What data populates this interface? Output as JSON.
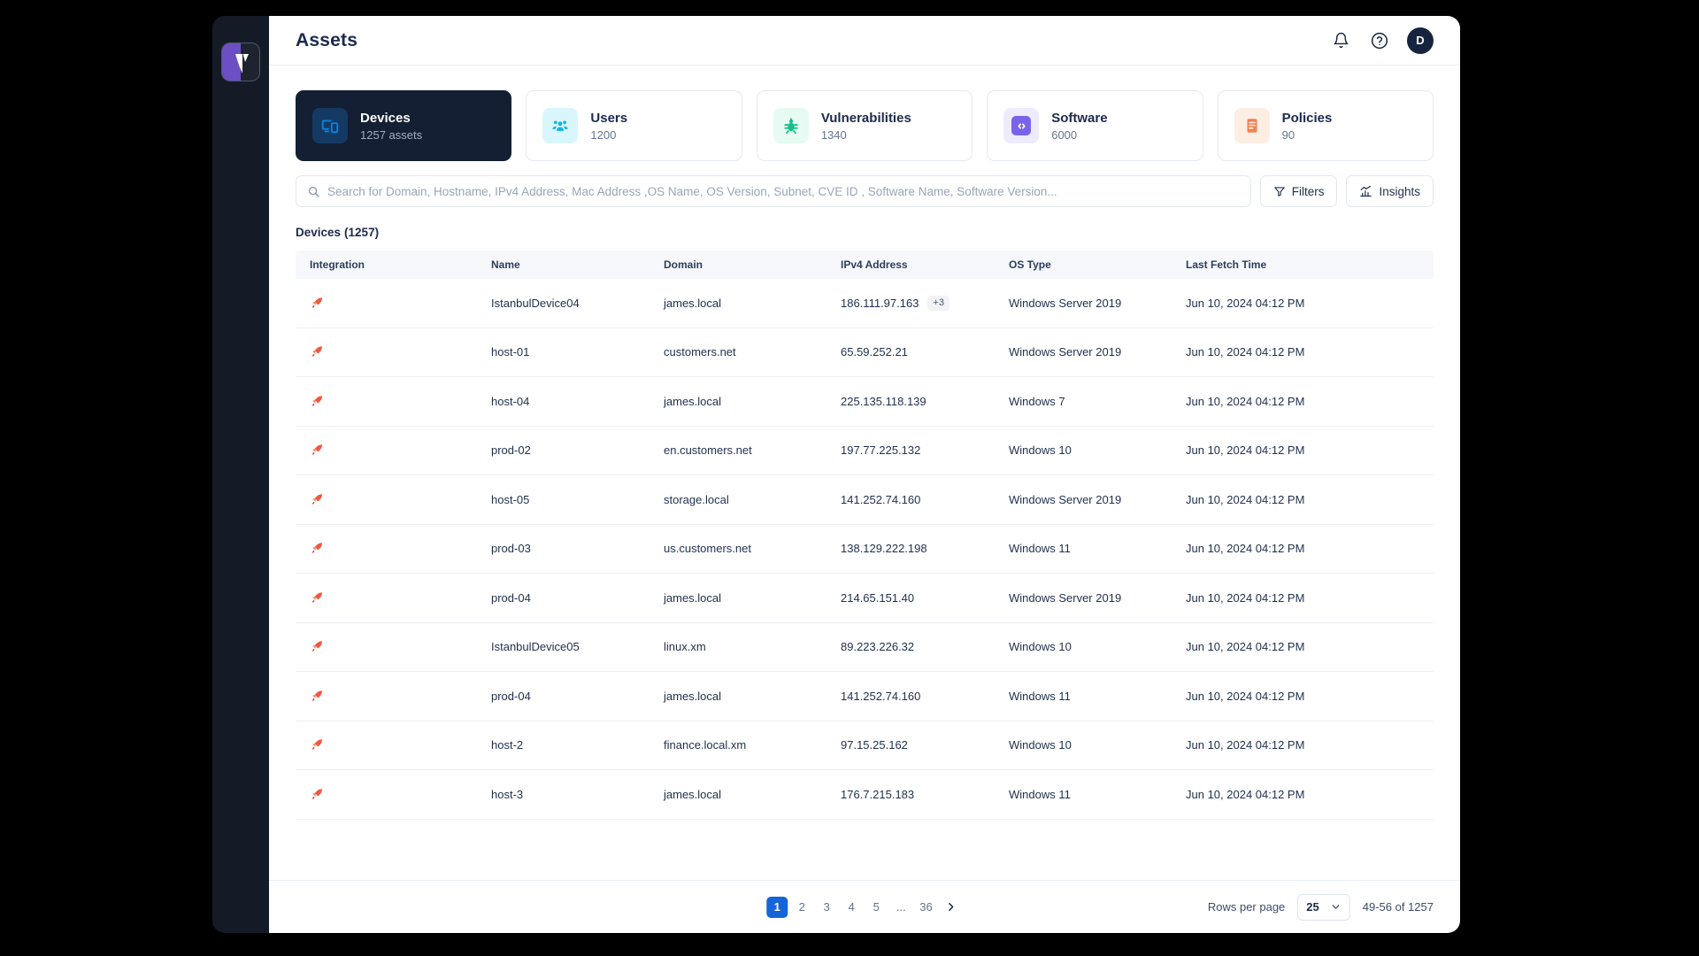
{
  "brand": {
    "logo_name": "vicarius-logo",
    "accent": "#6d4fc4",
    "rail_bg": "#141b26"
  },
  "header": {
    "title": "Assets",
    "bell_icon": "bell-icon",
    "help_icon": "question-circle-icon",
    "avatar_initial": "D"
  },
  "cards": [
    {
      "label": "Devices",
      "value": "1257 assets",
      "icon": "devices-icon",
      "icon_class": "ico-devices",
      "active": true
    },
    {
      "label": "Users",
      "value": "1200",
      "icon": "users-icon",
      "icon_class": "ico-users",
      "active": false
    },
    {
      "label": "Vulnerabilities",
      "value": "1340",
      "icon": "bug-icon",
      "icon_class": "ico-vuln",
      "active": false
    },
    {
      "label": "Software",
      "value": "6000",
      "icon": "code-brackets-icon",
      "icon_class": "ico-soft",
      "active": false
    },
    {
      "label": "Policies",
      "value": "90",
      "icon": "document-lines-icon",
      "icon_class": "ico-pol",
      "active": false
    }
  ],
  "search": {
    "placeholder": "Search for Domain, Hostname, IPv4 Address, Mac Address ,OS Name, OS Version, Subnet, CVE ID , Software Name, Software Version...",
    "value": "",
    "icon": "search-icon"
  },
  "toolbar": {
    "filters_label": "Filters",
    "filters_icon": "funnel-icon",
    "insights_label": "Insights",
    "insights_icon": "chart-bars-icon"
  },
  "table": {
    "title": "Devices",
    "count": "(1257)",
    "columns": [
      "Integration",
      "Name",
      "Domain",
      "IPv4 Address",
      "OS Type",
      "Last Fetch Time"
    ],
    "rows": [
      {
        "integration": "rocket-icon",
        "name": "IstanbulDevice04",
        "domain": "james.local",
        "ip": "186.111.97.163",
        "ip_extra": "+3",
        "os": "Windows Server 2019",
        "fetch": "Jun 10, 2024 04:12 PM"
      },
      {
        "integration": "rocket-icon",
        "name": "host-01",
        "domain": "customers.net",
        "ip": "65.59.252.21",
        "ip_extra": "",
        "os": "Windows Server 2019",
        "fetch": "Jun 10, 2024 04:12 PM"
      },
      {
        "integration": "rocket-icon",
        "name": "host-04",
        "domain": "james.local",
        "ip": "225.135.118.139",
        "ip_extra": "",
        "os": "Windows 7",
        "fetch": "Jun 10, 2024 04:12 PM"
      },
      {
        "integration": "rocket-icon",
        "name": "prod-02",
        "domain": "en.customers.net",
        "ip": "197.77.225.132",
        "ip_extra": "",
        "os": "Windows 10",
        "fetch": "Jun 10, 2024 04:12 PM"
      },
      {
        "integration": "rocket-icon",
        "name": "host-05",
        "domain": "storage.local",
        "ip": "141.252.74.160",
        "ip_extra": "",
        "os": "Windows Server 2019",
        "fetch": "Jun 10, 2024 04:12 PM"
      },
      {
        "integration": "rocket-icon",
        "name": "prod-03",
        "domain": "us.customers.net",
        "ip": "138.129.222.198",
        "ip_extra": "",
        "os": "Windows 11",
        "fetch": "Jun 10, 2024 04:12 PM"
      },
      {
        "integration": "rocket-icon",
        "name": "prod-04",
        "domain": "james.local",
        "ip": "214.65.151.40",
        "ip_extra": "",
        "os": "Windows Server 2019",
        "fetch": "Jun 10, 2024 04:12 PM"
      },
      {
        "integration": "rocket-icon",
        "name": "IstanbulDevice05",
        "domain": "linux.xm",
        "ip": "89.223.226.32",
        "ip_extra": "",
        "os": "Windows 10",
        "fetch": "Jun 10, 2024 04:12 PM"
      },
      {
        "integration": "rocket-icon",
        "name": "prod-04",
        "domain": "james.local",
        "ip": "141.252.74.160",
        "ip_extra": "",
        "os": "Windows 11",
        "fetch": "Jun 10, 2024 04:12 PM"
      },
      {
        "integration": "rocket-icon",
        "name": "host-2",
        "domain": "finance.local.xm",
        "ip": "97.15.25.162",
        "ip_extra": "",
        "os": "Windows 10",
        "fetch": "Jun 10, 2024 04:12 PM"
      },
      {
        "integration": "rocket-icon",
        "name": "host-3",
        "domain": "james.local",
        "ip": "176.7.215.183",
        "ip_extra": "",
        "os": "Windows 11",
        "fetch": "Jun 10, 2024 04:12 PM"
      }
    ]
  },
  "footer": {
    "pages": [
      "1",
      "2",
      "3",
      "4",
      "5",
      "...",
      "36"
    ],
    "current_page": "1",
    "next_icon": "chevron-right-icon",
    "rows_per_page_label": "Rows per page",
    "rows_per_page_value": "25",
    "rows_per_page_caret": "chevron-down-icon",
    "range": "49-56 of 1257"
  }
}
